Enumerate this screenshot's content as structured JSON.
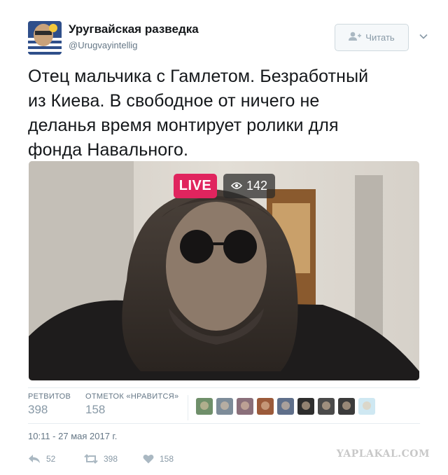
{
  "account": {
    "name": "Уругвайская разведка",
    "handle": "@Urugvayintellig",
    "follow_label": "Читать"
  },
  "tweet": {
    "text_lines": [
      "Отец мальчика с Гамлетом. Безработный",
      "из Киева. В свободное от ничего не",
      "деланья время монтирует ролики для",
      "фонда Навального."
    ]
  },
  "media": {
    "live_label": "LIVE",
    "viewers": "142"
  },
  "stats": {
    "retweets_label": "РЕТВИТОВ",
    "retweets_value": "398",
    "likes_label": "ОТМЕТОК «НРАВИТСЯ»",
    "likes_value": "158"
  },
  "liker_avatars": [
    "#6f8f6a",
    "#7d8c99",
    "#8a6f7a",
    "#9b5a3a",
    "#5f6f8a",
    "#2d2d2d",
    "#4a4a4a",
    "#3b3b3b",
    "#cfe8f2"
  ],
  "timestamp": "10:11 - 27 мая 2017 г.",
  "actions": {
    "reply_count": "52",
    "retweet_count": "398",
    "like_count": "158"
  },
  "watermark": "YAPLAKAL.COM",
  "colors": {
    "text": "#14171a",
    "muted": "#657786",
    "icon": "#8899a6",
    "live": "#e0245e",
    "border": "#e6ecf0"
  }
}
